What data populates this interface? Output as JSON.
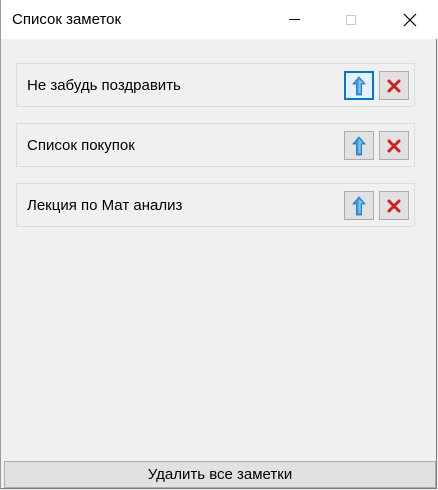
{
  "window": {
    "title": "Список заметок"
  },
  "notes": [
    {
      "title": "Не забудь поздравить"
    },
    {
      "title": "Список покупок"
    },
    {
      "title": "Лекция по Мат анализ"
    }
  ],
  "footer": {
    "delete_all_label": "Удалить все заметки"
  },
  "icons": {
    "up": "arrow-up-icon",
    "delete": "red-x-icon"
  },
  "colors": {
    "accent": "#0078d7",
    "delete_red": "#d01f1f",
    "arrow_blue": "#3a9be0"
  }
}
